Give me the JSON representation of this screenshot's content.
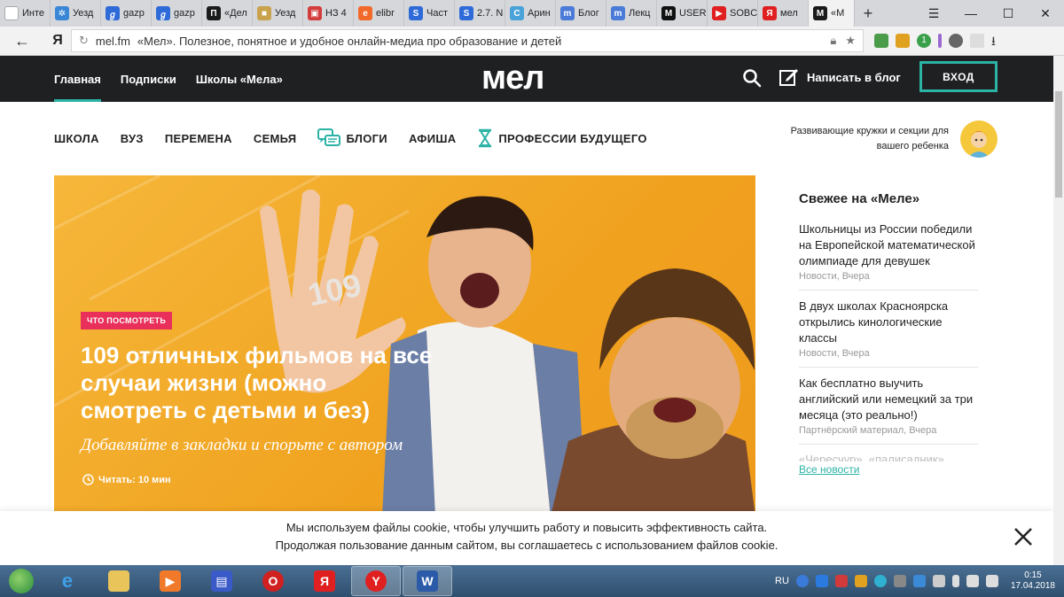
{
  "browser": {
    "tabs": [
      {
        "label": "Инте",
        "color": "#ffffff",
        "glyph": ""
      },
      {
        "label": "Уезд",
        "color": "#3a86d6",
        "glyph": "✲"
      },
      {
        "label": "gazp",
        "color": "#2f6bd8",
        "glyph": "ℊ"
      },
      {
        "label": "gazp",
        "color": "#2f6bd8",
        "glyph": "ℊ"
      },
      {
        "label": "«Дел",
        "color": "#1b1b1b",
        "glyph": "П"
      },
      {
        "label": "Уезд",
        "color": "#c8a24c",
        "glyph": "■"
      },
      {
        "label": "НЗ 4",
        "color": "#d23c3c",
        "glyph": "▣"
      },
      {
        "label": "elibr",
        "color": "#f26a2a",
        "glyph": "e"
      },
      {
        "label": "Част",
        "color": "#2f6bd8",
        "glyph": "S"
      },
      {
        "label": "2.7. N",
        "color": "#2f6bd8",
        "glyph": "S"
      },
      {
        "label": "Арин",
        "color": "#4aa3d8",
        "glyph": "С"
      },
      {
        "label": "Блог",
        "color": "#4a7bd8",
        "glyph": "m"
      },
      {
        "label": "Лекц",
        "color": "#4a7bd8",
        "glyph": "m"
      },
      {
        "label": "USER",
        "color": "#111111",
        "glyph": "M"
      },
      {
        "label": "SOBC",
        "color": "#e02020",
        "glyph": "▶"
      },
      {
        "label": "мел",
        "color": "#e02020",
        "glyph": "Я"
      },
      {
        "label": "«М",
        "color": "#1b1b1b",
        "glyph": "M"
      }
    ],
    "new_tab": "+",
    "address": {
      "host": "mel.fm",
      "title": "«Мел». Полезное, понятное и удобное онлайн-медиа про образование и детей"
    },
    "ya_button": "Я",
    "ext_badge": "1"
  },
  "site": {
    "logo": "мел",
    "nav": [
      "Главная",
      "Подписки",
      "Школы «Мела»"
    ],
    "write_label": "Написать в блог",
    "login_label": "ВХОД",
    "categories": [
      "ШКОЛА",
      "ВУЗ",
      "ПЕРЕМЕНА",
      "СЕМЬЯ",
      "БЛОГИ",
      "АФИША",
      "ПРОФЕССИИ БУДУЩЕГО"
    ],
    "promo_text": "Развивающие кружки и секции для вашего ребенка"
  },
  "hero": {
    "badge": "ЧТО ПОСМОТРЕТЬ",
    "title": "109 отличных фильмов на все случаи жизни (можно смотреть с детьми и без)",
    "subtitle": "Добавляйте в закладки и спорьте с автором",
    "read_time": "Читать: 10 мин",
    "hand_number": "109"
  },
  "sidebar": {
    "heading": "Свежее на «Меле»",
    "items": [
      {
        "title": "Школьницы из России победили на Европейской математической олимпиаде для девушек",
        "meta": "Новости, Вчера"
      },
      {
        "title": "В двух школах Красноярска открылись кинологические классы",
        "meta": "Новости, Вчера"
      },
      {
        "title": "Как бесплатно выучить английский или немецкий за три месяца (это реально!)",
        "meta": "Партнёрский материал, Вчера"
      }
    ],
    "faded_item": "«Чересчур», «палисадник»",
    "all_news": "Все новости"
  },
  "cookie": {
    "line1": "Мы используем файлы cookie, чтобы улучшить работу и повысить эффективность сайта.",
    "line2": "Продолжая пользование данным сайтом, вы соглашаетесь с использованием файлов cookie."
  },
  "taskbar": {
    "lang": "RU",
    "time": "0:15",
    "date": "17.04.2018"
  }
}
